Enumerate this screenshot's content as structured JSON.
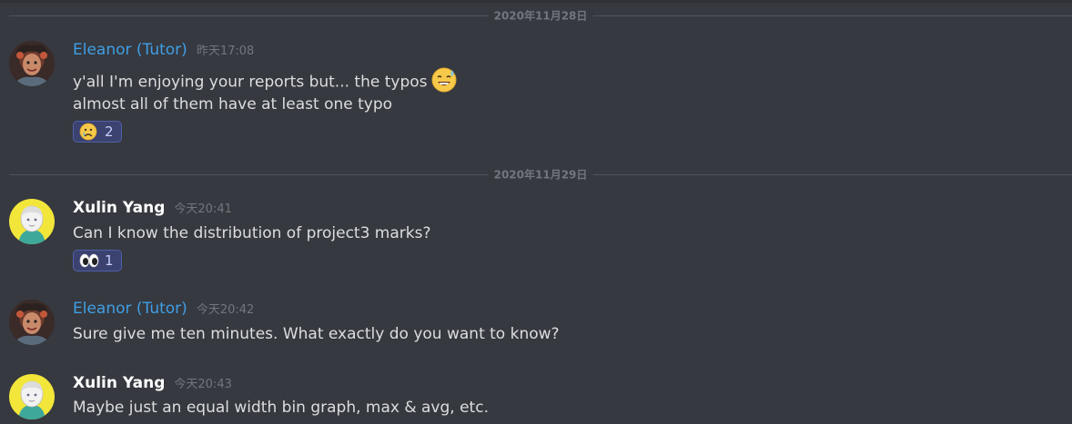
{
  "dividers": [
    {
      "label": "2020年11月28日"
    },
    {
      "label": "2020年11月29日"
    }
  ],
  "messages": [
    {
      "author": "Eleanor (Tutor)",
      "time": "昨天17:08",
      "lines": [
        "y'all I'm enjoying your reports but... the typos",
        "almost all of them have at least one typo"
      ],
      "inline_emoji": "sweat-smile-emoji",
      "reaction": {
        "emoji": "crying-face-emoji",
        "count": "2"
      }
    },
    {
      "author": "Xulin Yang",
      "time": "今天20:41",
      "lines": [
        "Can I know the distribution of project3 marks?"
      ],
      "reaction": {
        "emoji": "eyes-emoji",
        "count": "1"
      }
    },
    {
      "author": "Eleanor (Tutor)",
      "time": "今天20:42",
      "lines": [
        "Sure give me ten minutes. What exactly do you want to know?"
      ]
    },
    {
      "author": "Xulin Yang",
      "time": "今天20:43",
      "lines": [
        "Maybe just an equal width bin graph, max & avg, etc."
      ]
    }
  ],
  "colors": {
    "background": "#36393f",
    "tutor_name": "#3f9ee6",
    "student_name": "#ffffff",
    "message_text": "#dcddde",
    "timestamp": "#72767d",
    "reaction_bg": "#3c4270"
  }
}
